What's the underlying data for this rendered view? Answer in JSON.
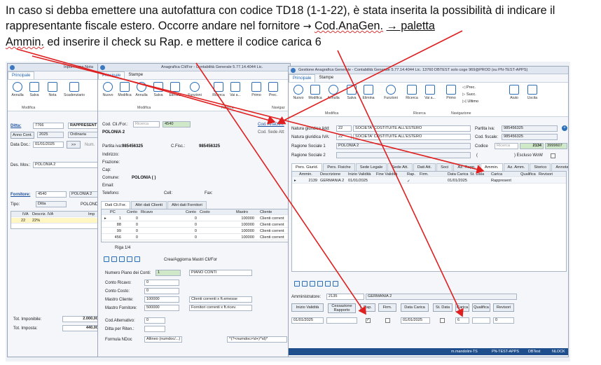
{
  "caption": {
    "part1": "In caso si debba emettere una autofattura con codice TD18 (1-1-22), è stata inserita la possibilità di indicare il rappresentante fiscale estero. Occorre andare nel fornitore ",
    "arrow": "→",
    "cod_anagen": "Cod.AnaGen.",
    "part2": " ",
    "paletta": "→ paletta",
    "ammin": "Ammin.",
    "part3": " ed inserire il check su Rap. e mettere il codice carica 6"
  },
  "win1": {
    "title": "Input Prima Nota",
    "tab": "Principale",
    "buttons": [
      "Annulla",
      "Salva",
      "Nota",
      "Scadenziario"
    ],
    "group": "Modifica",
    "ditta_label": "Ditta:",
    "ditta_value": "7766",
    "ditta_name": "RAPPRESENT",
    "anno_label": "Anno Cont.",
    "anno_value": "2025",
    "ordinaria": "Ordinaria",
    "datadoc_label": "Data Doc.:",
    "datadoc_value": "01/01/2025",
    "num_label": "Num.",
    "desmov_label": "Des. Mov.:",
    "desmov_value": "POLONIA 2",
    "fornitore_label": "Fornitore:",
    "fornitore_value": "4540",
    "fornitore_name": "POLONIA 2",
    "tipo_label": "Tipo:",
    "tipo_value": "Ditta",
    "tipo_extra": "POLOND",
    "iva_cols": [
      "IVA",
      "Descriz. IVA",
      "Imp"
    ],
    "iva_row": [
      "22",
      "22%"
    ],
    "tot_imp_label": "Tot. Imponibile:",
    "tot_imp_value": "2.000,00",
    "tot_iva_label": "Tot. Imposta:",
    "tot_iva_value": "440,00"
  },
  "win2": {
    "title": "Anagrafica Cli/For - Contabilità Generale 5.77.14.4044 Lic.",
    "tabs": [
      "Principale",
      "Stampe"
    ],
    "buttons": [
      "Nuovo",
      "Modifica",
      "Annulla",
      "Salva",
      "Elimina",
      "Funzioni",
      "Ricerca",
      "Vai a...",
      "Primo",
      "Prec."
    ],
    "groups": [
      "Modifica",
      "Ricerca",
      "Navigaz"
    ],
    "codcli_label": "Cod. Cli./For.:",
    "codcli_ph": "Ricerca",
    "codcli_value": "4540",
    "cod_anagen_link": "Cod. AnaGen.",
    "cod_sede_label": "Cod. Sede Att:",
    "name": "POLONIA 2",
    "piva_label": "Partita iva:",
    "piva_value": "985456325",
    "cfisc_label": "C.Fisc.:",
    "cfisc_value": "985456325",
    "indirizzo": "Indirizzo:",
    "frazione": "Frazione:",
    "cap": "Cap:",
    "comune_label": "Comune:",
    "comune_value": "POLONIA ( )",
    "email": "Email:",
    "telefono": "Telefono:",
    "cell": "Cell:",
    "fax": "Fax:",
    "subtabs": [
      "Dati Cli.For.",
      "Altri dati Clienti",
      "Altri dati Fornitori"
    ],
    "grid_cols": [
      "PC",
      "Conto",
      "Ricavo",
      "Conto",
      "Costo",
      "Mastro",
      "Cliente"
    ],
    "grid_rows": [
      [
        "1",
        "0",
        "0",
        "100000",
        "Clienti corrent"
      ],
      [
        "88",
        "0",
        "0",
        "100000",
        "Clienti corrent"
      ],
      [
        "99",
        "0",
        "0",
        "100000",
        "Clienti corrent"
      ],
      [
        "456",
        "0",
        "0",
        "100000",
        "Clienti corrent"
      ]
    ],
    "riga_label": "Riga 1/4",
    "crea_button": "Crea/Aggiorna Mastri Cli/For",
    "num_piano_label": "Numero Piano dei Conti:",
    "num_piano_value": "1",
    "piano_conti": "PIANO CONTI",
    "conto_ricavo": "Conto Ricavo:",
    "conto_costo": "Conto Costo:",
    "mastro_cliente_label": "Mastro Cliente:",
    "mastro_cliente_value": "100000",
    "mastro_cliente_desc": "Clienti correnti x ft.emesse",
    "mastro_forn_label": "Mastro Fornitore:",
    "mastro_forn_value": "500000",
    "mastro_forn_desc": "Fornitori correnti x ft.ricev.",
    "cod_alt_label": "Cod.Alternativo:",
    "ditta_riten_label": "Ditta per Riten.:",
    "formula_label": "Formula NDoc",
    "formula_value": "Allineo (numdoc/...)",
    "formula_expr": "^(?<numdoc>\\d+)^\\d)*",
    "zero": "0"
  },
  "win3": {
    "title": "Gestione Anagrafica Generale - Contabilità Generale 5.77.14.4044 Lic. 13760 DBTEST solo coge 969@PROD (su PN-TEST-APPS)",
    "tabs": [
      "Principale",
      "Stampe"
    ],
    "buttons": [
      "Nuovo",
      "Modifica",
      "Annulla",
      "Salva",
      "Elimina",
      "Funzioni",
      "Ricerca",
      "Vai a...",
      "Primo"
    ],
    "nav_buttons": [
      "Prec.",
      "Succ.",
      "Ultimo"
    ],
    "right_buttons": [
      "Aiuto",
      "Uscita"
    ],
    "groups": [
      "Modifica",
      "Ricerca",
      "Navigazione"
    ],
    "natgiu_label": "Natura giuridica iidd:",
    "natgiu_code": "22",
    "natgiu_value": "SOCIETA' COSTITUITE ALL'ESTERO",
    "natgiu_iva_label": "Natura giuridica IVA:",
    "natgiu_iva_code": "22",
    "natgiu_iva_value": "SOCIETA' COSTITUITE ALL'ESTERO",
    "ragsoc1_label": "Ragione Sociale 1",
    "ragsoc1_value": "POLONIA 2",
    "ragsoc2_label": "Ragione Sociale 2",
    "piva_label": "Partita iva:",
    "piva_value": "985456325",
    "codfisc_label": "Cod. fiscale:",
    "codfisc_value": "985456325",
    "codice_label": "Codice",
    "codice_ph": "Ricerca",
    "codice_value": "2134",
    "codice_extra": "3999607",
    "escluso_label": ") Escluso WoW",
    "paren_open": "(",
    "tabs2": [
      "Pers. Giurid.",
      "Pers. Fisiche",
      "Sede Legale",
      "Sede Att.",
      "Dati Att.",
      "Soci",
      "Az. Rapp.",
      "Ammin.",
      "Az. Amm.",
      "Storico",
      "Annotazioni"
    ],
    "grid_cols": [
      "Ammin.",
      "Descrizione",
      "Inizio Validità",
      "Fine Validità",
      "Rap.",
      "Firm.",
      "Data Carica",
      "St. Data",
      "Carica",
      "Qualifica",
      "Revisori"
    ],
    "grid_row": [
      "2139",
      "GERMANIA 2",
      "01/01/2025",
      "01/01/2025",
      "Rappresent"
    ],
    "amm_label": "Amministratore:",
    "amm_value": "2135",
    "amm_name": "GERMANIA 2",
    "bottom_buttons": [
      "Inizio Validità",
      "Cessazione Rapporto",
      "Rap.",
      "Firm.",
      "Data Carica",
      "St. Data",
      "Carica",
      "Qualifica",
      "Revisori"
    ],
    "inizio_value": "01/01/2025",
    "datacarica_value": "01/01/2025",
    "carica_value": "6",
    "revisori_value": "0",
    "status": [
      "m.mandolini-TS",
      "PN-TEST-APPS",
      "DBTest",
      "NLOCK"
    ]
  }
}
